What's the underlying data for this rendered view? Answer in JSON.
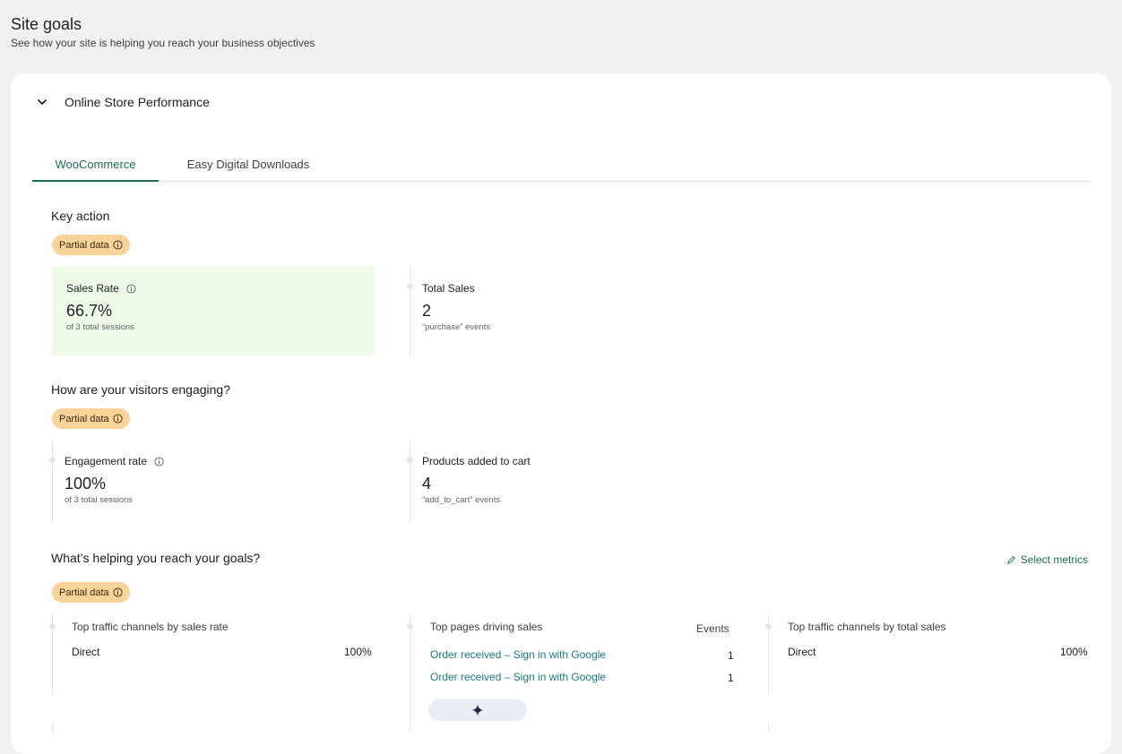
{
  "page": {
    "title": "Site goals",
    "subtitle": "See how your site is helping you reach your business objectives"
  },
  "section": {
    "title": "Online Store Performance"
  },
  "tabs": [
    {
      "label": "WooCommerce",
      "active": true
    },
    {
      "label": "Easy Digital Downloads",
      "active": false
    }
  ],
  "key_action": {
    "heading": "Key action",
    "badge": "Partial data",
    "metrics": [
      {
        "label": "Sales Rate",
        "value": "66.7%",
        "sub": "of 3 total sessions"
      },
      {
        "label": "Total Sales",
        "value": "2",
        "sub": "“purchase” events"
      }
    ]
  },
  "engagement": {
    "heading": "How are your visitors engaging?",
    "badge": "Partial data",
    "metrics": [
      {
        "label": "Engagement rate",
        "value": "100%",
        "sub": "of 3 total sessions"
      },
      {
        "label": "Products added to cart",
        "value": "4",
        "sub": "“add_to_cart” events"
      }
    ]
  },
  "helping": {
    "heading": "What’s helping you reach your goals?",
    "badge": "Partial data",
    "select_metrics": "Select metrics",
    "columns": [
      {
        "title": "Top traffic channels by sales rate",
        "rows": [
          {
            "name": "Direct",
            "value": "100%"
          }
        ]
      },
      {
        "title": "Top pages driving sales",
        "value_header": "Events",
        "rows": [
          {
            "name": "Order received – Sign in with Google",
            "value": "1"
          },
          {
            "name": "Order received – Sign in with Google",
            "value": "1"
          }
        ]
      },
      {
        "title": "Top traffic channels by total sales",
        "rows": [
          {
            "name": "Direct",
            "value": "100%"
          }
        ]
      }
    ]
  },
  "colors": {
    "accent": "#1b6e57",
    "link": "#1b7a83",
    "badge": "#fad39b",
    "highlight": "#eefbe9"
  },
  "icons": {
    "collapse": "chevron-down-icon",
    "info": "info-icon",
    "edit": "pencil-icon",
    "ai": "sparkle-icon"
  }
}
